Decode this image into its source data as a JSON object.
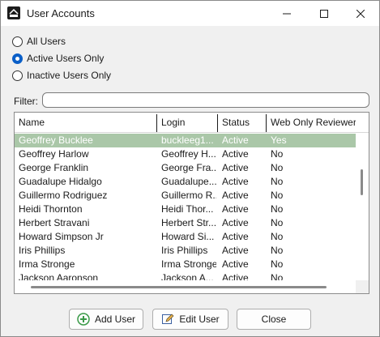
{
  "window": {
    "title": "User Accounts"
  },
  "radios": [
    {
      "label": "All Users",
      "checked": false
    },
    {
      "label": "Active Users Only",
      "checked": true
    },
    {
      "label": "Inactive Users Only",
      "checked": false
    }
  ],
  "filter": {
    "label": "Filter:",
    "value": ""
  },
  "grid": {
    "headers": [
      "Name",
      "Login",
      "Status",
      "Web Only Reviewer"
    ],
    "rows": [
      {
        "name": "Geoffrey Bucklee",
        "login": "buckleeg1...",
        "status": "Active",
        "web": "Yes",
        "selected": true
      },
      {
        "name": "Geoffrey Harlow",
        "login": "Geoffrey H...",
        "status": "Active",
        "web": "No"
      },
      {
        "name": "George Franklin",
        "login": "George Fra...",
        "status": "Active",
        "web": "No"
      },
      {
        "name": "Guadalupe Hidalgo",
        "login": "Guadalupe...",
        "status": "Active",
        "web": "No"
      },
      {
        "name": "Guillermo Rodriguez",
        "login": "Guillermo R...",
        "status": "Active",
        "web": "No"
      },
      {
        "name": "Heidi Thornton",
        "login": "Heidi Thor...",
        "status": "Active",
        "web": "No"
      },
      {
        "name": "Herbert Stravani",
        "login": "Herbert Str...",
        "status": "Active",
        "web": "No"
      },
      {
        "name": "Howard Simpson Jr",
        "login": "Howard Si...",
        "status": "Active",
        "web": "No"
      },
      {
        "name": "Iris Phillips",
        "login": "Iris Phillips",
        "status": "Active",
        "web": "No"
      },
      {
        "name": "Irma Stronge",
        "login": "Irma Stronge",
        "status": "Active",
        "web": "No"
      },
      {
        "name": "Jackson Aaronson",
        "login": "Jackson A...",
        "status": "Active",
        "web": "No"
      }
    ]
  },
  "buttons": {
    "add": "Add User",
    "edit": "Edit User",
    "close": "Close"
  },
  "icons": {
    "app": "app-logo-icon",
    "add": "plus-circle-icon",
    "edit": "pencil-icon"
  },
  "colors": {
    "selected_row": "#aac7a8",
    "radio_accent": "#0a5fc8",
    "add_icon": "#3a9a48"
  }
}
